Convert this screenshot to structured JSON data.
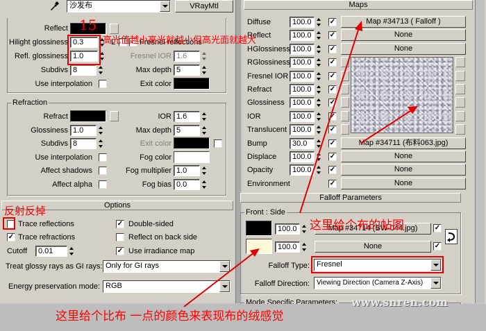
{
  "material": {
    "name": "沙发布",
    "type": "VRayMtl"
  },
  "reflection": {
    "reflect_label": "Reflect",
    "hilight_glossiness_label": "Hilight glossiness",
    "hilight_glossiness_value": "0.3",
    "lock_label": "L",
    "fresnel_reflections_label": "Fresnel reflections",
    "refl_glossiness_label": "Refl. glossiness",
    "refl_glossiness_value": "1.0",
    "fresnel_ior_label": "Fresnel IOR",
    "fresnel_ior_value": "1.6",
    "subdivs_label": "Subdivs",
    "subdivs_value": "8",
    "max_depth_label": "Max depth",
    "max_depth_value": "5",
    "use_interpolation_label": "Use interpolation",
    "exit_color_label": "Exit color"
  },
  "refraction": {
    "group_label": "Refraction",
    "refract_label": "Refract",
    "ior_label": "IOR",
    "ior_value": "1.6",
    "glossiness_label": "Glossiness",
    "glossiness_value": "1.0",
    "max_depth_label": "Max depth",
    "max_depth_value": "5",
    "subdivs_label": "Subdivs",
    "subdivs_value": "8",
    "exit_color_label": "Exit color",
    "use_interpolation_label": "Use interpolation",
    "fog_color_label": "Fog color",
    "affect_shadows_label": "Affect shadows",
    "fog_multiplier_label": "Fog multiplier",
    "fog_multiplier_value": "1.0",
    "affect_alpha_label": "Affect alpha",
    "fog_bias_label": "Fog bias",
    "fog_bias_value": "0.0"
  },
  "options": {
    "rollout_label": "Options",
    "trace_reflections_label": "Trace reflections",
    "trace_reflections_checked": false,
    "double_sided_label": "Double-sided",
    "trace_refractions_label": "Trace refractions",
    "reflect_on_back_side_label": "Reflect on back side",
    "cutoff_label": "Cutoff",
    "cutoff_value": "0.01",
    "use_irradiance_map_label": "Use irradiance map",
    "treat_glossy_label": "Treat glossy rays as GI rays:",
    "treat_glossy_value": "Only for GI rays",
    "energy_mode_label": "Energy preservation mode:",
    "energy_mode_value": "RGB"
  },
  "maps": {
    "rollout_label": "Maps",
    "rows": [
      {
        "label": "Diffuse",
        "amount": "100.0",
        "map": "Map #34713  ( Falloff )"
      },
      {
        "label": "Reflect",
        "amount": "100.0",
        "map": "None"
      },
      {
        "label": "HGlossiness",
        "amount": "100.0",
        "map": "None"
      },
      {
        "label": "RGlossiness",
        "amount": "100.0",
        "map": ""
      },
      {
        "label": "Fresnel IOR",
        "amount": "100.0",
        "map": ""
      },
      {
        "label": "Refract",
        "amount": "100.0",
        "map": ""
      },
      {
        "label": "Glossiness",
        "amount": "100.0",
        "map": ""
      },
      {
        "label": "IOR",
        "amount": "100.0",
        "map": ""
      },
      {
        "label": "Translucent",
        "amount": "100.0",
        "map": ""
      },
      {
        "label": "Bump",
        "amount": "30.0",
        "map": "Map #34711 (布料063.jpg)"
      },
      {
        "label": "Displace",
        "amount": "100.0",
        "map": "None"
      },
      {
        "label": "Opacity",
        "amount": "100.0",
        "map": "None"
      },
      {
        "label": "Environment",
        "amount": "",
        "map": "None"
      }
    ]
  },
  "falloff": {
    "rollout_label": "Falloff Parameters",
    "group_label": "Front : Side",
    "front_amount": "100.0",
    "front_map": "Map #34714 (BW-044.jpg)",
    "side_amount": "100.0",
    "side_map": "None",
    "falloff_type_label": "Falloff Type:",
    "falloff_type_value": "Fresnel",
    "falloff_direction_label": "Falloff Direction:",
    "falloff_direction_value": "Viewing Direction (Camera Z-Axis)",
    "mode_specific_label": "Mode Specific Parameters:",
    "front_color": "#000000",
    "side_color": "#fff8d8"
  },
  "annotations": {
    "step_number": "15",
    "highlight_note": "高光值越小高光就越小但高光面就越大",
    "reflection_note": "反射反掉",
    "map_note": "这里给个布的帖图",
    "bottom_note": "这里给个比布   一点的颜色来表现布的绒感觉",
    "watermark": "www.snren.com"
  }
}
